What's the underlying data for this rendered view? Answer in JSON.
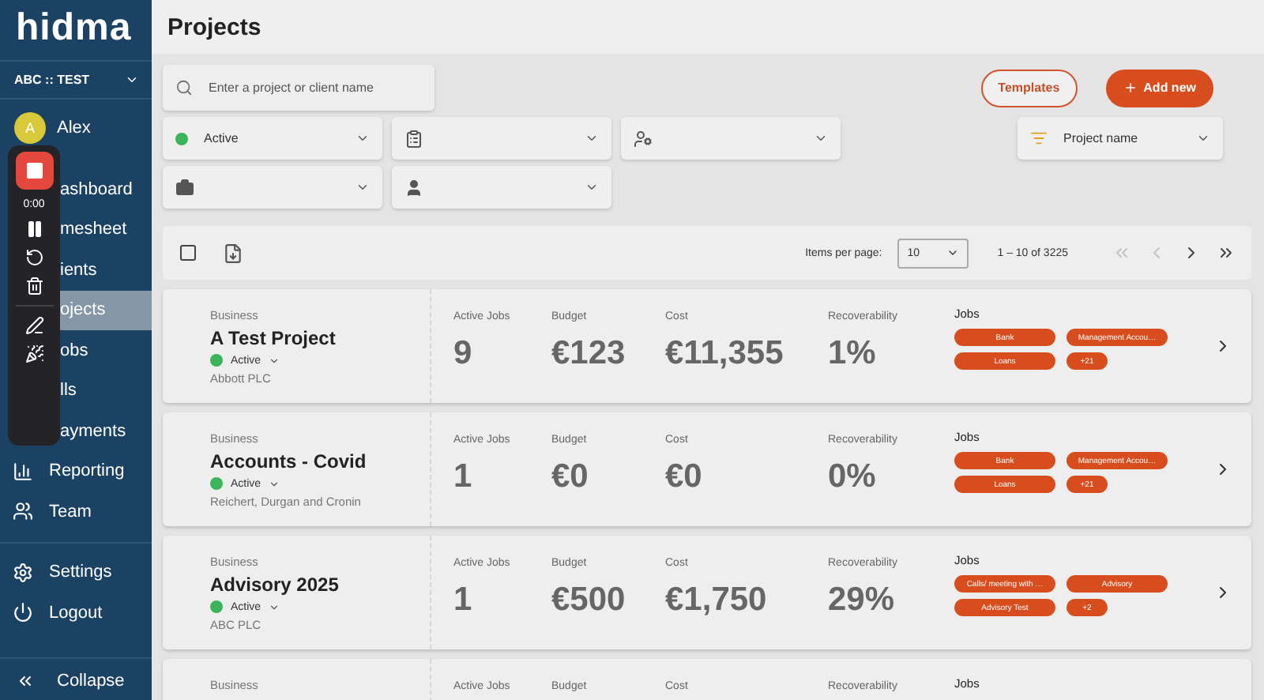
{
  "sidebar": {
    "logo": "hidma",
    "account": "ABC :: TEST",
    "user": {
      "initial": "A",
      "name": "Alex"
    },
    "items": [
      {
        "label": "ashboard",
        "selected": false
      },
      {
        "label": "mesheet",
        "selected": false
      },
      {
        "label": "ients",
        "selected": false
      },
      {
        "label": "ojects",
        "selected": true
      },
      {
        "label": "obs",
        "selected": false
      },
      {
        "label": "lls",
        "selected": false
      },
      {
        "label": "ayments",
        "selected": false
      },
      {
        "label": "Reporting",
        "selected": false
      },
      {
        "label": "Team",
        "selected": false
      }
    ],
    "bottom_items": [
      {
        "label": "Settings"
      },
      {
        "label": "Logout"
      }
    ],
    "collapse": "Collapse"
  },
  "recorder": {
    "time": "0:00"
  },
  "header": {
    "title": "Projects"
  },
  "search": {
    "placeholder": "Enter a project or client name"
  },
  "buttons": {
    "templates": "Templates",
    "add_new": "Add new"
  },
  "filters": [
    {
      "value": "Active"
    }
  ],
  "sort": {
    "value": "Project name"
  },
  "toolbar": {
    "select_all_checked": false,
    "items_per_page_label": "Items per page:",
    "items_per_page": "10",
    "range": "1 – 10 of 3225",
    "first_disabled": true,
    "prev_disabled": true
  },
  "projects": [
    {
      "type": "Business",
      "name": "A Test Project",
      "status": "Active",
      "client": "Abbott PLC",
      "stats": [
        {
          "label": "Active Jobs",
          "value": "9"
        },
        {
          "label": "Budget",
          "value": "€123"
        },
        {
          "label": "Cost",
          "value": "€11,355"
        },
        {
          "label": "Recoverability",
          "value": "1%"
        }
      ],
      "jobs_label": "Jobs",
      "jobs": [
        "Bank",
        "Management Accou…",
        "Loans",
        "+21"
      ]
    },
    {
      "type": "Business",
      "name": "Accounts - Covid",
      "status": "Active",
      "client": "Reichert, Durgan and Cronin",
      "stats": [
        {
          "label": "Active Jobs",
          "value": "1"
        },
        {
          "label": "Budget",
          "value": "€0"
        },
        {
          "label": "Cost",
          "value": "€0"
        },
        {
          "label": "Recoverability",
          "value": "0%"
        }
      ],
      "jobs_label": "Jobs",
      "jobs": [
        "Bank",
        "Management Accou…",
        "Loans",
        "+21"
      ]
    },
    {
      "type": "Business",
      "name": "Advisory 2025",
      "status": "Active",
      "client": "ABC PLC",
      "stats": [
        {
          "label": "Active Jobs",
          "value": "1"
        },
        {
          "label": "Budget",
          "value": "€500"
        },
        {
          "label": "Cost",
          "value": "€1,750"
        },
        {
          "label": "Recoverability",
          "value": "29%"
        }
      ],
      "jobs_label": "Jobs",
      "jobs": [
        "Calls/ meeting with …",
        "Advisory",
        "Advisory Test",
        "+2"
      ]
    },
    {
      "type": "Business",
      "stats": [
        {
          "label": "Active Jobs"
        },
        {
          "label": "Budget"
        },
        {
          "label": "Cost"
        },
        {
          "label": "Recoverability"
        }
      ],
      "jobs_label": "Jobs"
    }
  ]
}
